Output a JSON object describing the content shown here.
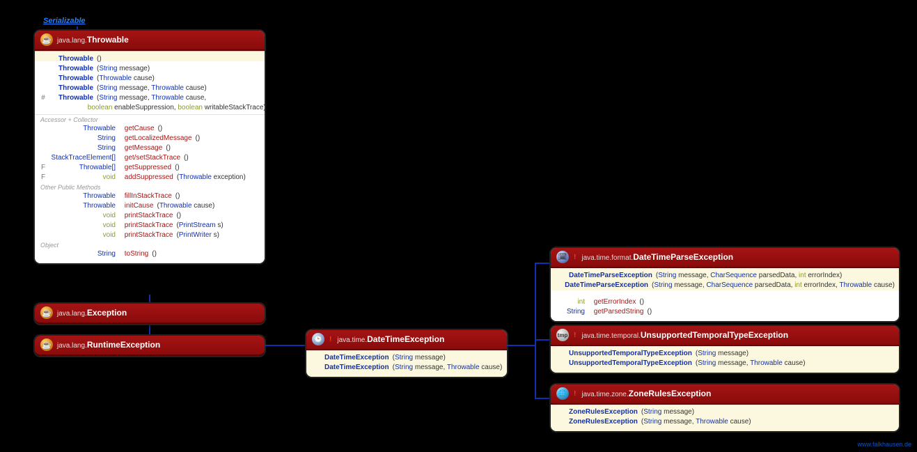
{
  "interfaceLink": "Serializable",
  "footer": "www.falkhausen.de",
  "throwable": {
    "pkg": "java.lang.",
    "name": "Throwable",
    "ctors": [
      {
        "name": "Throwable",
        "params": "()"
      },
      {
        "name": "Throwable",
        "params": "(String message)"
      },
      {
        "name": "Throwable",
        "params": "(Throwable cause)"
      },
      {
        "name": "Throwable",
        "params": "(String message, Throwable cause)"
      },
      {
        "name": "Throwable",
        "params": "(String message, Throwable cause,",
        "mod": "#",
        "cont": "boolean enableSuppression, boolean writableStackTrace)"
      }
    ],
    "accLabel": "Accessor + Collector",
    "accessors": [
      {
        "ret": "Throwable",
        "name": "getCause",
        "params": "()"
      },
      {
        "ret": "String",
        "name": "getLocalizedMessage",
        "params": "()"
      },
      {
        "ret": "String",
        "name": "getMessage",
        "params": "()"
      },
      {
        "ret": "StackTraceElement[]",
        "name": "get/setStackTrace",
        "params": "()"
      },
      {
        "ret": "Throwable[]",
        "name": "getSuppressed",
        "params": "()",
        "flag": "F"
      },
      {
        "ret": "void",
        "name": "addSuppressed",
        "params": "(Throwable exception)",
        "flag": "F"
      }
    ],
    "pubLabel": "Other Public Methods",
    "publics": [
      {
        "ret": "Throwable",
        "name": "fillInStackTrace",
        "params": "()"
      },
      {
        "ret": "Throwable",
        "name": "initCause",
        "params": "(Throwable cause)"
      },
      {
        "ret": "void",
        "name": "printStackTrace",
        "params": "()"
      },
      {
        "ret": "void",
        "name": "printStackTrace",
        "params": "(PrintStream s)"
      },
      {
        "ret": "void",
        "name": "printStackTrace",
        "params": "(PrintWriter s)"
      }
    ],
    "objLabel": "Object",
    "objects": [
      {
        "ret": "String",
        "name": "toString",
        "params": "()"
      }
    ]
  },
  "exception": {
    "pkg": "java.lang.",
    "name": "Exception"
  },
  "runtimeException": {
    "pkg": "java.lang.",
    "name": "RuntimeException"
  },
  "dateTimeException": {
    "pkg": "java.time.",
    "name": "DateTimeException",
    "ctors": [
      {
        "name": "DateTimeException",
        "params": "(String message)"
      },
      {
        "name": "DateTimeException",
        "params": "(String message, Throwable cause)"
      }
    ]
  },
  "dateTimeParseException": {
    "pkg": "java.time.format.",
    "name": "DateTimeParseException",
    "ctors": [
      {
        "name": "DateTimeParseException",
        "params": "(String message, CharSequence parsedData, int errorIndex)"
      },
      {
        "name": "DateTimeParseException",
        "params": "(String message, CharSequence parsedData, int errorIndex, Throwable cause)"
      }
    ],
    "methods": [
      {
        "ret": "int",
        "name": "getErrorIndex",
        "params": "()"
      },
      {
        "ret": "String",
        "name": "getParsedString",
        "params": "()"
      }
    ]
  },
  "unsupportedTemporalTypeException": {
    "pkg": "java.time.temporal.",
    "name": "UnsupportedTemporalTypeException",
    "ctors": [
      {
        "name": "UnsupportedTemporalTypeException",
        "params": "(String message)"
      },
      {
        "name": "UnsupportedTemporalTypeException",
        "params": "(String message, Throwable cause)"
      }
    ]
  },
  "zoneRulesException": {
    "pkg": "java.time.zone.",
    "name": "ZoneRulesException",
    "ctors": [
      {
        "name": "ZoneRulesException",
        "params": "(String message)"
      },
      {
        "name": "ZoneRulesException",
        "params": "(String message, Throwable cause)"
      }
    ]
  }
}
